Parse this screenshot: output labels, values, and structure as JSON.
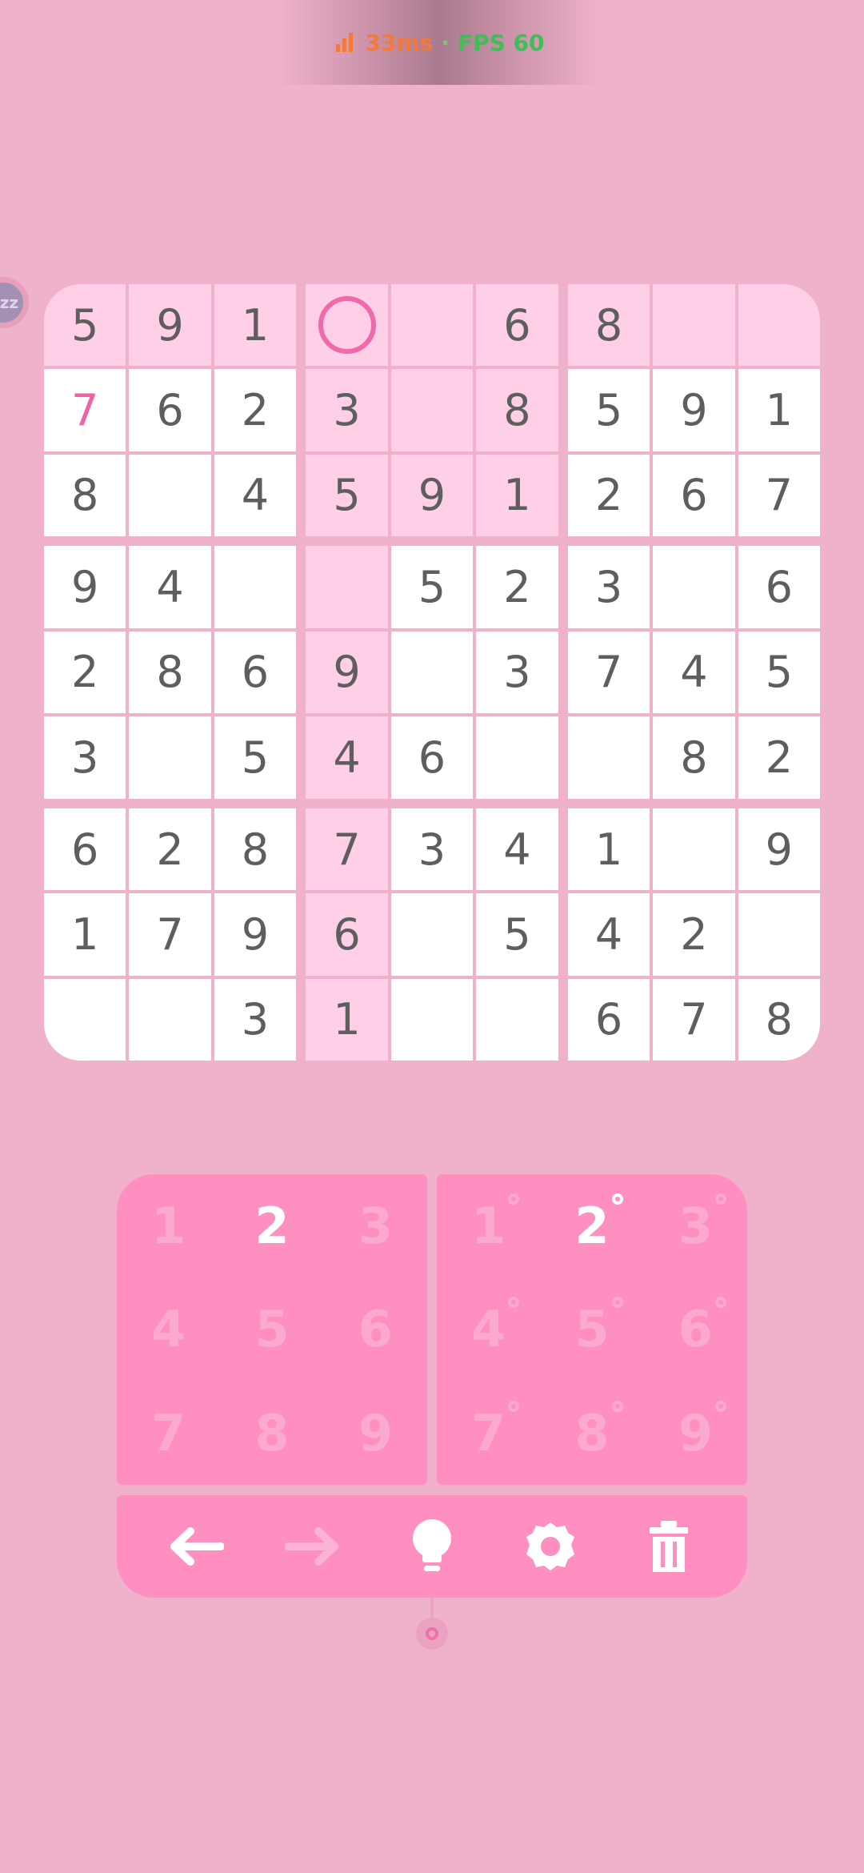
{
  "status": {
    "ping": "33ms",
    "separator": "·",
    "fps": "FPS 60"
  },
  "sleep_bubble": "zz",
  "board": {
    "rows": [
      [
        "5",
        "9",
        "1",
        "",
        "",
        "6",
        "8",
        "",
        ""
      ],
      [
        "7",
        "6",
        "2",
        "3",
        "",
        "8",
        "5",
        "9",
        "1"
      ],
      [
        "8",
        "",
        "4",
        "5",
        "9",
        "1",
        "2",
        "6",
        "7"
      ],
      [
        "9",
        "4",
        "",
        "",
        "5",
        "2",
        "3",
        "",
        "6"
      ],
      [
        "2",
        "8",
        "6",
        "9",
        "",
        "3",
        "7",
        "4",
        "5"
      ],
      [
        "3",
        "",
        "5",
        "4",
        "6",
        "",
        "",
        "8",
        "2"
      ],
      [
        "6",
        "2",
        "8",
        "7",
        "3",
        "4",
        "1",
        "",
        "9"
      ],
      [
        "1",
        "7",
        "9",
        "6",
        "",
        "5",
        "4",
        "2",
        ""
      ],
      [
        "",
        "",
        "3",
        "1",
        "",
        "",
        "6",
        "7",
        "8"
      ]
    ],
    "selected": [
      0,
      3
    ],
    "highlight_row": 0,
    "highlight_col": 3,
    "highlight_box": [
      0,
      1
    ],
    "user_entries": [
      [
        1,
        0
      ]
    ],
    "colors": {
      "given": "#5e5e5e",
      "user": "#f061a6",
      "highlight": "#fecfe6",
      "cell": "#ffffff",
      "selection_ring": "#f06aaa"
    }
  },
  "pads": {
    "normal": {
      "keys": [
        "1",
        "2",
        "3",
        "4",
        "5",
        "6",
        "7",
        "8",
        "9"
      ],
      "active": "2"
    },
    "notes": {
      "keys": [
        "1",
        "2",
        "3",
        "4",
        "5",
        "6",
        "7",
        "8",
        "9"
      ],
      "active": "2"
    }
  },
  "toolbar": {
    "tools": [
      {
        "name": "undo",
        "icon": "arrow-left-icon",
        "enabled": true
      },
      {
        "name": "redo",
        "icon": "arrow-right-icon",
        "enabled": false
      },
      {
        "name": "hint",
        "icon": "lightbulb-icon",
        "enabled": true
      },
      {
        "name": "settings",
        "icon": "gear-icon",
        "enabled": true
      },
      {
        "name": "erase",
        "icon": "trash-icon",
        "enabled": true
      }
    ]
  },
  "theme": {
    "background": "#f0b2cb",
    "pad": "#ff8fc1",
    "pad_inactive": "#fba9cf",
    "pad_active": "#ffffff"
  }
}
